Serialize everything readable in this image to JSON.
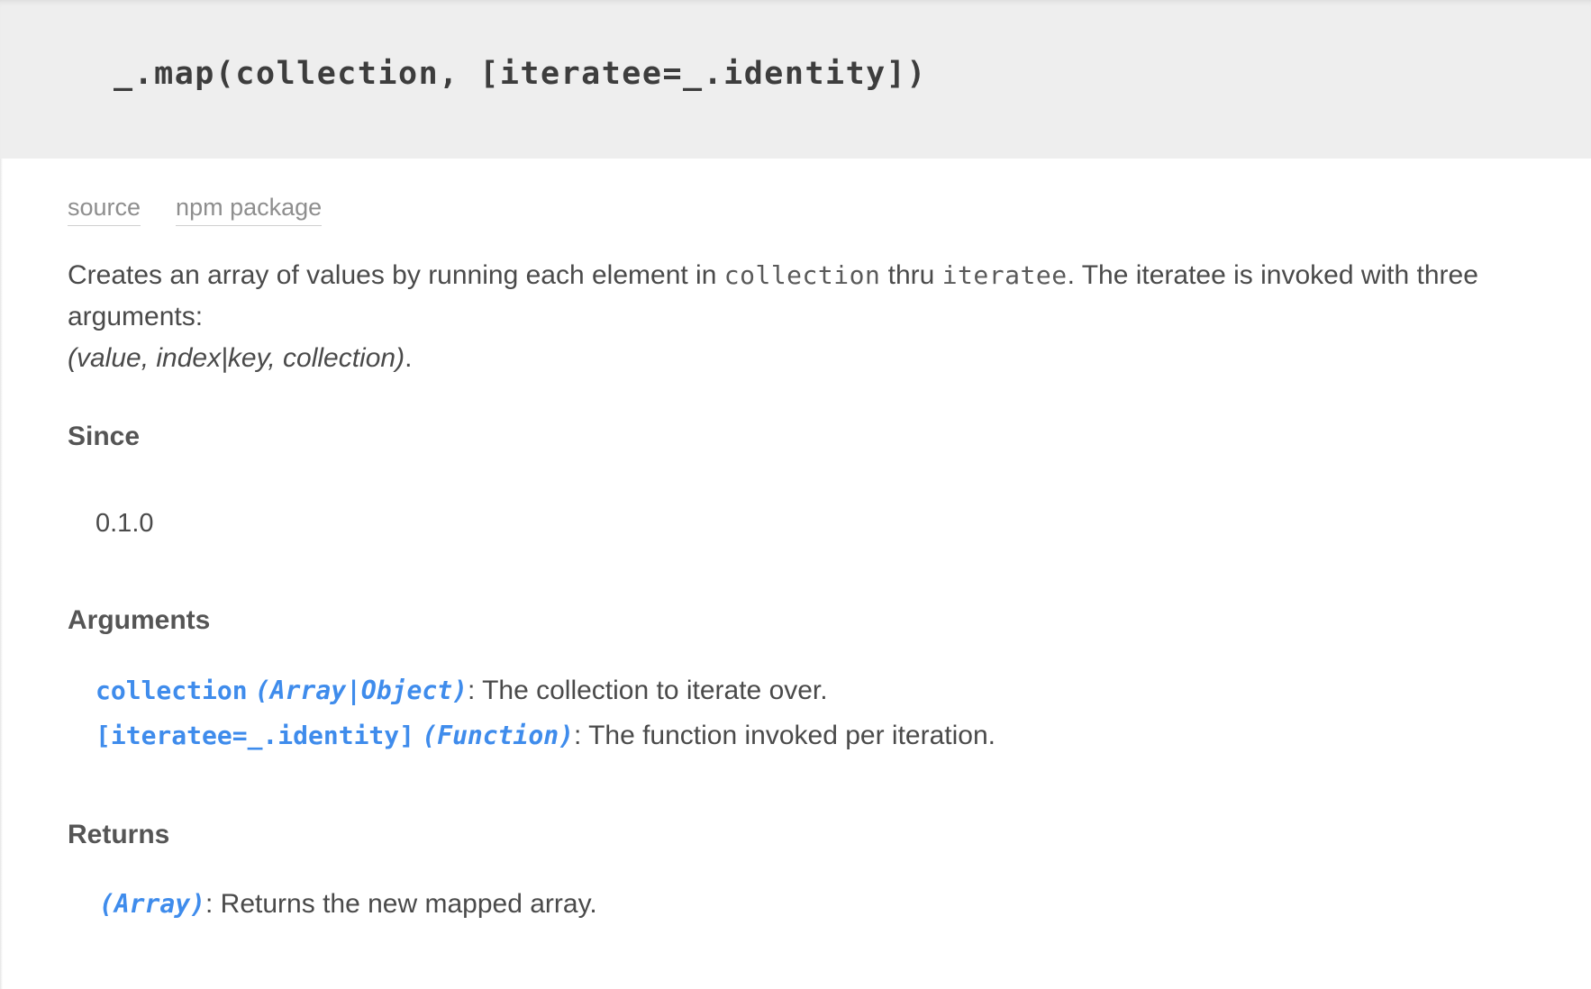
{
  "signature": "_.map(collection, [iteratee=_.identity])",
  "meta_links": {
    "source": "source",
    "npm_package": "npm package"
  },
  "description": {
    "text_1": "Creates an array of values by running each element in ",
    "code_1": "collection",
    "text_2": " thru ",
    "code_2": "iteratee",
    "text_3": ". The iteratee is invoked with three arguments:",
    "args_em": "(value, index|key, collection)",
    "end": "."
  },
  "since": {
    "title": "Since",
    "version": "0.1.0"
  },
  "arguments": {
    "title": "Arguments",
    "items": [
      {
        "name": "collection",
        "type": "(Array|Object)",
        "desc": ": The collection to iterate over."
      },
      {
        "name": "[iteratee=_.identity]",
        "type": "(Function)",
        "desc": ": The function invoked per iteration."
      }
    ]
  },
  "returns": {
    "title": "Returns",
    "type": "(Array)",
    "desc": ": Returns the new mapped array."
  },
  "colors": {
    "param_blue": "#3f8cec",
    "header_bg": "#eeeeee",
    "text": "#4a4a4a"
  }
}
